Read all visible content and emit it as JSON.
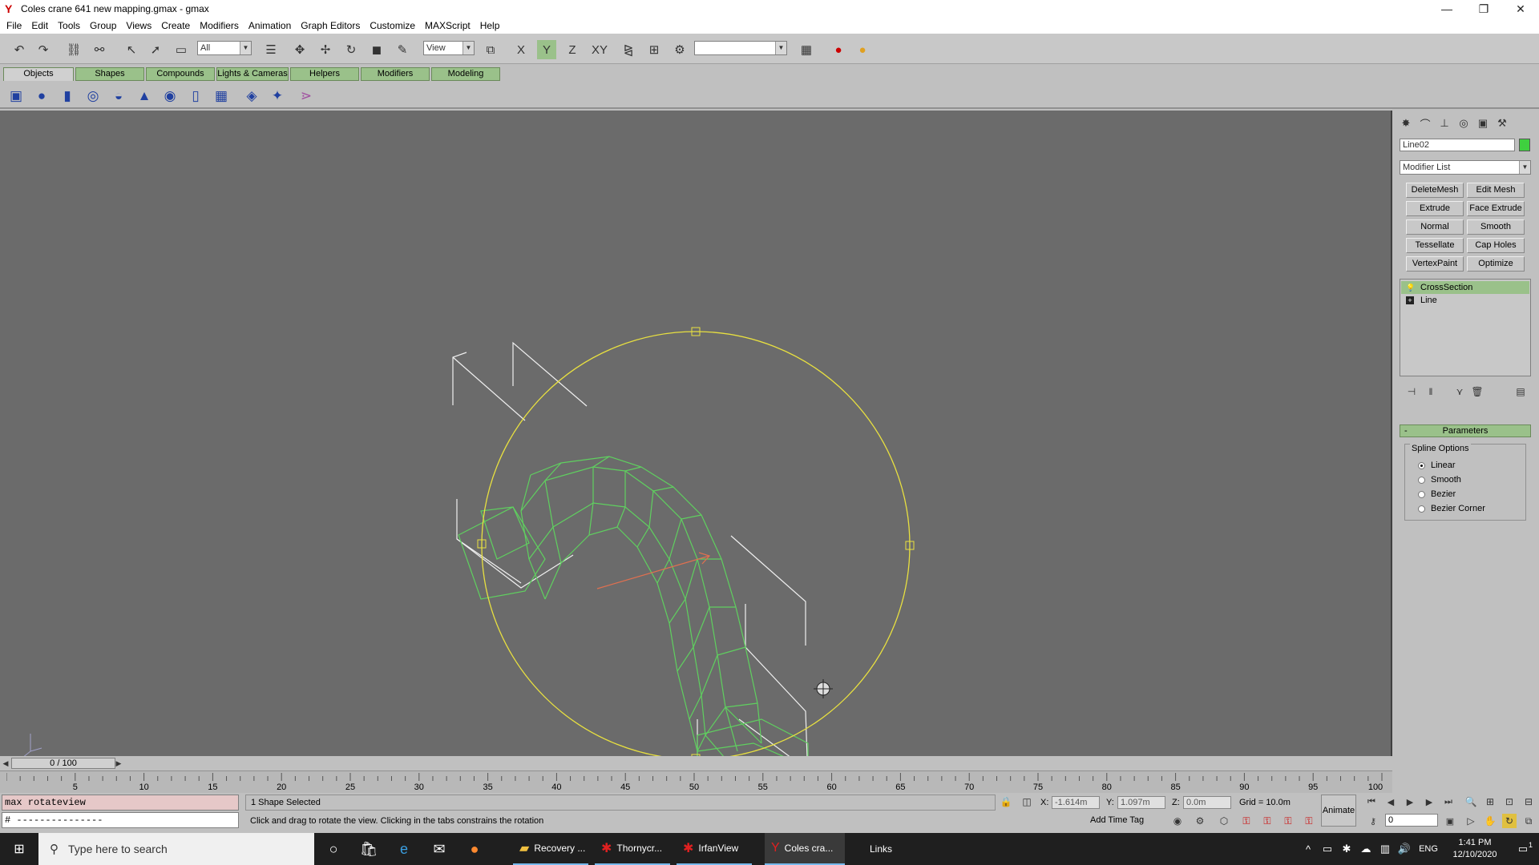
{
  "window": {
    "title": "Coles crane 641 new mapping.gmax - gmax",
    "minimize": "—",
    "restore": "❐",
    "close": "✕"
  },
  "menu": [
    "File",
    "Edit",
    "Tools",
    "Group",
    "Views",
    "Create",
    "Modifiers",
    "Animation",
    "Graph Editors",
    "Customize",
    "MAXScript",
    "Help"
  ],
  "toolbar": {
    "selection_filter": "All",
    "ref_coord": "View",
    "axis_labels": [
      "X",
      "Y",
      "Z",
      "XY"
    ],
    "named_selection": ""
  },
  "tabs": [
    "Objects",
    "Shapes",
    "Compounds",
    "Lights & Cameras",
    "Helpers",
    "Modifiers",
    "Modeling"
  ],
  "active_tab": "Objects",
  "command_panel": {
    "object_name": "Line02",
    "object_color": "#3fd03f",
    "modifier_list": "Modifier List",
    "modifier_buttons": [
      "DeleteMesh",
      "Edit Mesh",
      "Extrude",
      "Face Extrude",
      "Normal",
      "Smooth",
      "Tessellate",
      "Cap Holes",
      "VertexPaint",
      "Optimize"
    ],
    "stack": [
      {
        "label": "CrossSection",
        "icon": "lightbulb-icon",
        "selected": true
      },
      {
        "label": "Line",
        "icon": "plus-box-icon",
        "selected": false
      }
    ],
    "parameters_title": "Parameters",
    "parameters_toggle": "-",
    "spline_options_title": "Spline Options",
    "spline_options": [
      {
        "label": "Linear",
        "checked": true
      },
      {
        "label": "Smooth",
        "checked": false
      },
      {
        "label": "Bezier",
        "checked": false
      },
      {
        "label": "Bezier Corner",
        "checked": false
      }
    ]
  },
  "timeline": {
    "slider_label": "0 / 100",
    "ticks": [
      "5",
      "10",
      "15",
      "20",
      "25",
      "30",
      "35",
      "40",
      "45",
      "50",
      "55",
      "60",
      "65",
      "70",
      "75",
      "80",
      "85",
      "90",
      "95",
      "100"
    ]
  },
  "status": {
    "maxscript_line": "max rotateview",
    "maxscript_output": "# ---------------",
    "selection": "1 Shape Selected",
    "prompt": "Click and drag to rotate the view.  Clicking in the tabs constrains the rotation",
    "x_label": "X:",
    "x_value": "-1.614m",
    "y_label": "Y:",
    "y_value": "1.097m",
    "z_label": "Z:",
    "z_value": "0.0m",
    "grid": "Grid = 10.0m",
    "add_time_tag": "Add Time Tag",
    "animate": "Animate",
    "frame": "0"
  },
  "taskbar": {
    "search_placeholder": "Type here to search",
    "apps": [
      {
        "label": "Recovery ...",
        "icon": "folder-icon"
      },
      {
        "label": "Thornycr...",
        "icon": "irfanview-icon"
      },
      {
        "label": "IrfanView",
        "icon": "irfanview-icon"
      },
      {
        "label": "Coles cra...",
        "icon": "gmax-icon"
      }
    ],
    "links": "Links",
    "language": "ENG",
    "time": "1:41 PM",
    "date": "12/10/2020",
    "notification_count": "1"
  },
  "colors": {
    "viewport_bg": "#6b6b6b",
    "selected_spline": "#e8e040",
    "mesh_wire": "#5fd05f",
    "helper_wire": "#ffffff",
    "tab_green": "#9ac18a"
  }
}
